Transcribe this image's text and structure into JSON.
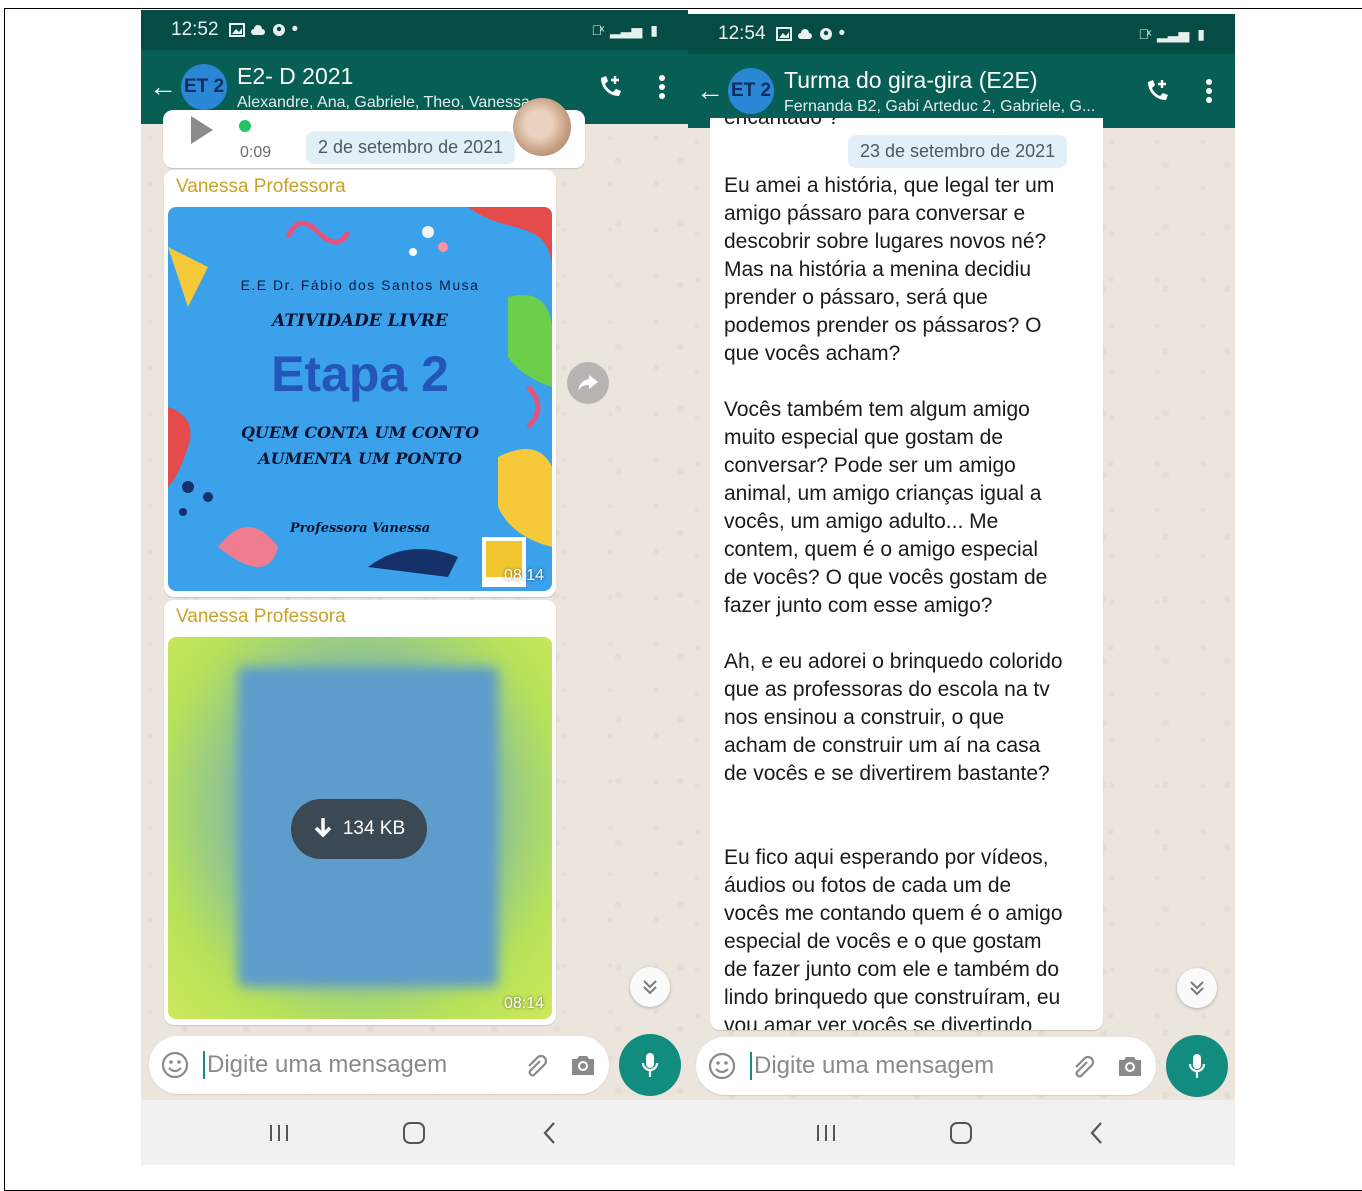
{
  "left": {
    "status": {
      "time": "12:52"
    },
    "header": {
      "avatar": "ET 2",
      "title": "E2- D 2021",
      "subtitle": "Alexandre, Ana, Gabriele, Theo, Vanessa, ..."
    },
    "voice": {
      "duration": "0:09"
    },
    "date_pill": "2 de setembro de 2021",
    "msg1": {
      "sender": "Vanessa Professora",
      "poster": {
        "school": "E.E Dr. Fábio dos Santos Musa",
        "activity": "ATIVIDADE LIVRE",
        "etapa": "Etapa 2",
        "subtitle": "QUEM CONTA UM CONTO AUMENTA UM PONTO",
        "teacher": "Professora Vanessa"
      },
      "time": "08:14"
    },
    "msg2": {
      "sender": "Vanessa Professora",
      "download": "134 KB",
      "time": "08:14"
    },
    "input": {
      "placeholder": "Digite uma mensagem"
    }
  },
  "right": {
    "status": {
      "time": "12:54"
    },
    "header": {
      "avatar": "ET 2",
      "title": "Turma do  gira-gira (E2E)",
      "subtitle": "Fernanda B2, Gabi Arteduc 2, Gabriele, G..."
    },
    "cut_top": "encantado ?",
    "date_pill": "23 de setembro de 2021",
    "message": "Eu amei a história, que legal ter um\namigo pássaro para conversar e\ndescobrir sobre lugares novos né?\nMas na história a menina decidiu\nprender o pássaro,  será que\npodemos prender os pássaros? O\nque vocês acham?\n\nVocês também tem algum amigo\nmuito especial que gostam de\nconversar? Pode ser um amigo\nanimal, um amigo crianças igual a\nvocês, um amigo adulto... Me\ncontem, quem é o amigo especial\nde vocês? O que vocês gostam de\nfazer junto com esse amigo?\n\nAh, e eu adorei o brinquedo colorido\nque as professoras do escola na tv\nnos ensinou a construir, o que\nacham de construir um aí na casa\nde vocês e se divertirem bastante?\n\n\nEu fico aqui esperando por vídeos,\náudios ou fotos de cada um de\nvocês me contando quem é o amigo\nespecial de vocês e o que gostam\nde fazer junto com ele e também do\nlindo brinquedo que construíram, eu\nvou amar ver vocês se divertindo",
    "input": {
      "placeholder": "Digite uma mensagem"
    }
  },
  "colors": {
    "header": "#075e54",
    "status": "#054d44",
    "sender": "#c9a227",
    "mic": "#128c7e"
  }
}
